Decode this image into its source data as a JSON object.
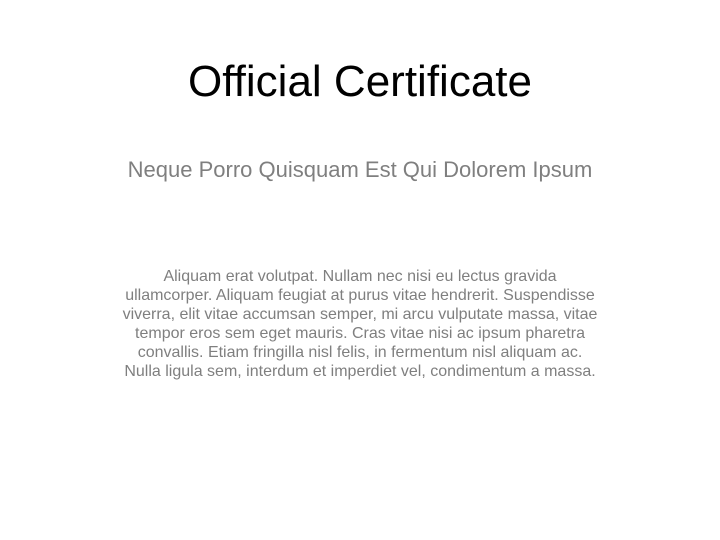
{
  "certificate": {
    "title": "Official Certificate",
    "subtitle": "Neque Porro Quisquam Est Qui Dolorem Ipsum",
    "body": "Aliquam erat volutpat. Nullam nec nisi eu lectus gravida ullamcorper. Aliquam feugiat at purus vitae hendrerit. Suspendisse viverra, elit vitae accumsan semper, mi arcu vulputate massa, vitae tempor eros sem eget mauris. Cras vitae nisi ac ipsum pharetra convallis. Etiam fringilla nisl felis, in fermentum nisl aliquam ac. Nulla ligula sem, interdum et imperdiet vel, condimentum a massa."
  },
  "colors": {
    "title": "#000000",
    "subtitle": "#7f7f7f",
    "body": "#7f7f7f",
    "background": "#ffffff"
  }
}
